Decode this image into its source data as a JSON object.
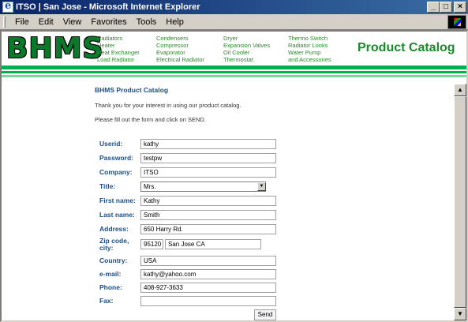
{
  "window": {
    "title": "ITSO | San Jose - Microsoft Internet Explorer",
    "min_label": "_",
    "max_label": "□",
    "close_label": "×"
  },
  "menu": [
    "File",
    "Edit",
    "View",
    "Favorites",
    "Tools",
    "Help"
  ],
  "header": {
    "logo": "BHMS",
    "nav_columns": [
      [
        "Radiators",
        "Heater",
        "Heat Exchanger",
        "Load Radiator"
      ],
      [
        "Condensers",
        "Compressor",
        "Evaporator",
        "Electrical Radiator"
      ],
      [
        "Dryer",
        "Expansion Valves",
        "Oil Cooler",
        "Thermostat"
      ],
      [
        "Thermo Switch",
        "Radiator Looks",
        "Water Pump",
        "and Accessories"
      ]
    ],
    "catalog_title": "Product Catalog"
  },
  "content": {
    "heading": "BHMS Product Catalog",
    "intro1": "Thank you for your interest in using our product catalog.",
    "intro2": "Please fill out the form and click on SEND."
  },
  "form": {
    "userid": {
      "label": "Userid:",
      "value": "kathy"
    },
    "password": {
      "label": "Password:",
      "value": "testpw"
    },
    "company": {
      "label": "Company:",
      "value": "ITSO"
    },
    "title": {
      "label": "Title:",
      "value": "Mrs."
    },
    "firstname": {
      "label": "First name:",
      "value": "Kathy"
    },
    "lastname": {
      "label": "Last name:",
      "value": "Smith"
    },
    "address": {
      "label": "Address:",
      "value": "650 Harry Rd."
    },
    "zipcity": {
      "label_line1": "Zip code,",
      "label_line2": "city:",
      "zip": "95120",
      "city": "San Jose CA"
    },
    "country": {
      "label": "Country:",
      "value": "USA"
    },
    "email": {
      "label": "e-mail:",
      "value": "kathy@yahoo.com"
    },
    "phone": {
      "label": "Phone:",
      "value": "408-927-3633"
    },
    "fax": {
      "label": "Fax:",
      "value": ""
    },
    "send_label": "Send"
  },
  "colors": {
    "brand_green": "#00b050",
    "label_blue": "#1a4f8a",
    "titlebar": "#0a246a"
  },
  "icons": [
    "ie-app-icon",
    "windows-logo-throbber",
    "scroll-up-arrow-icon",
    "scroll-down-arrow-icon",
    "dropdown-arrow-icon"
  ]
}
